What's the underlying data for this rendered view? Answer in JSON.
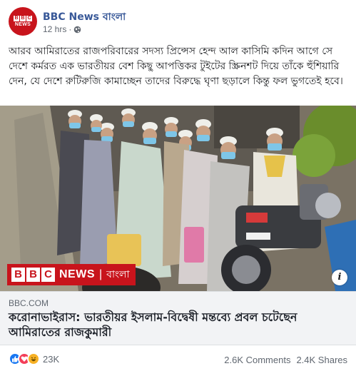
{
  "header": {
    "avatar_letters": [
      "B",
      "B",
      "C"
    ],
    "avatar_sub": "NEWS",
    "page_name": "BBC News বাংলা",
    "time": "12 hrs",
    "separator": "·",
    "privacy_icon": "globe-icon"
  },
  "post": {
    "text": "আরব আমিরাতের রাজপরিবারের সদস্য প্রিন্সেস হেন্দ আল কাসিমি কদিন আগে সে দেশে কর্মরত এক ভারতীয়র বেশ কিছু আপত্তিকর টুইটের স্ক্রিনশট দিয়ে তাঁকে হুঁশিয়ারি দেন, যে দেশে রুটিরুজি কামাচ্ছেন তাদের বিরুদ্ধে ঘৃণা ছড়ালে কিন্তু ফল ভুগতেই হবে।"
  },
  "image": {
    "logo_letters": [
      "B",
      "B",
      "C"
    ],
    "logo_news": "NEWS",
    "logo_sep": "|",
    "logo_lang": "বাংলা",
    "info_label": "i"
  },
  "link": {
    "domain": "BBC.COM",
    "title": "করোনাভাইরাস: ভারতীয়র ইসলাম-বিদ্বেষী মন্তব্যে প্রবল চটেছেন আমিরাতের রাজকুমারী"
  },
  "footer": {
    "reactions": [
      "like-icon",
      "love-icon",
      "haha-icon"
    ],
    "reaction_count": "23K",
    "comments": "2.6K Comments",
    "shares": "2.4K Shares"
  },
  "colors": {
    "brand_red": "#c8141c",
    "link_blue": "#385898",
    "like_blue": "#1877f2",
    "love_red": "#f33e58",
    "haha_yellow": "#f7b125"
  }
}
